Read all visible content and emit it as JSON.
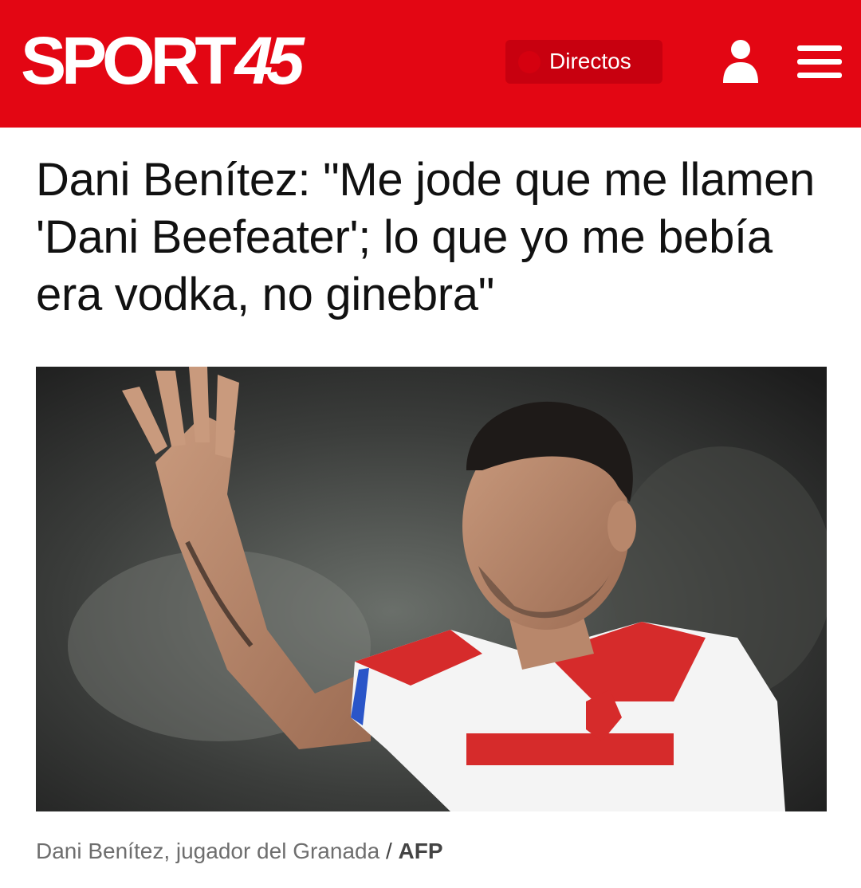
{
  "header": {
    "brand_text": "SPORT",
    "brand_number": "45",
    "live_label": "Directos",
    "background_color": "#e30613",
    "live_button_color": "#c8000f",
    "user_icon": "user-icon",
    "menu_icon": "hamburger-menu-icon"
  },
  "article": {
    "title": "Dani Benítez: \"Me jode que me llamen 'Dani Beefeater'; lo que yo me bebía era vodka, no ginebra\"",
    "image_description_icon": "article-photo",
    "caption": "Dani Benítez, jugador del Granada",
    "caption_separator": "/",
    "credit": "AFP"
  }
}
